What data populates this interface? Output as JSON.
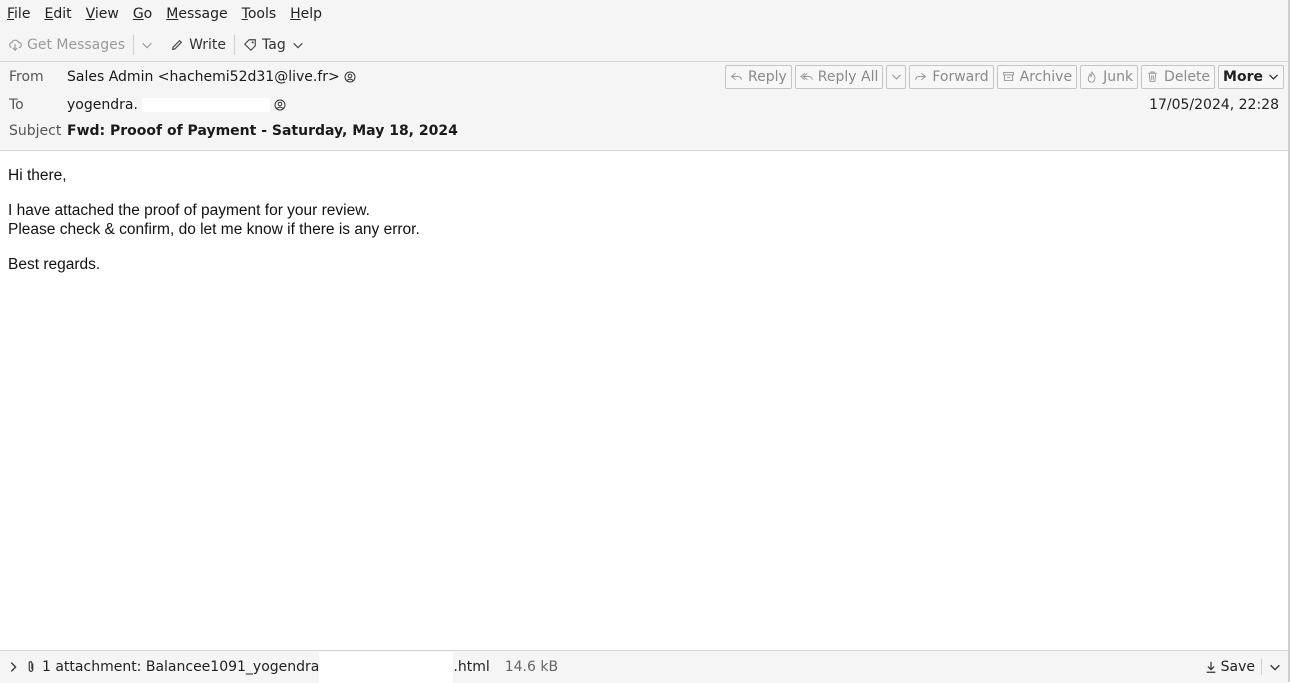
{
  "menubar": {
    "items": [
      {
        "key": "F",
        "rest": "ile"
      },
      {
        "key": "E",
        "rest": "dit"
      },
      {
        "key": "V",
        "rest": "iew"
      },
      {
        "key": "G",
        "rest": "o"
      },
      {
        "key": "M",
        "rest": "essage"
      },
      {
        "key": "T",
        "rest": "ools"
      },
      {
        "key": "H",
        "rest": "elp"
      }
    ]
  },
  "toolbar": {
    "get_messages": "Get Messages",
    "write": "Write",
    "tag": "Tag"
  },
  "header": {
    "from_label": "From",
    "from_value": "Sales Admin <hachemi52d31@live.fr>",
    "to_label": "To",
    "to_value": "yogendra.",
    "subject_label": "Subject",
    "subject_value": "Fwd: Prooof of Payment - Saturday, May 18, 2024",
    "date": "17/05/2024, 22:28",
    "actions": {
      "reply": "Reply",
      "reply_all": "Reply All",
      "forward": "Forward",
      "archive": "Archive",
      "junk": "Junk",
      "delete": "Delete",
      "more": "More"
    }
  },
  "body": {
    "greeting": "Hi there,",
    "line1": "I have attached the proof of payment for your review.",
    "line2": "Please check & confirm, do let me know if there is any error.",
    "closing": "Best regards."
  },
  "attachment": {
    "label_start": "1 attachment: Balancee1091_yogendra",
    "label_end": ".html",
    "size": "14.6 kB",
    "save": "Save"
  }
}
